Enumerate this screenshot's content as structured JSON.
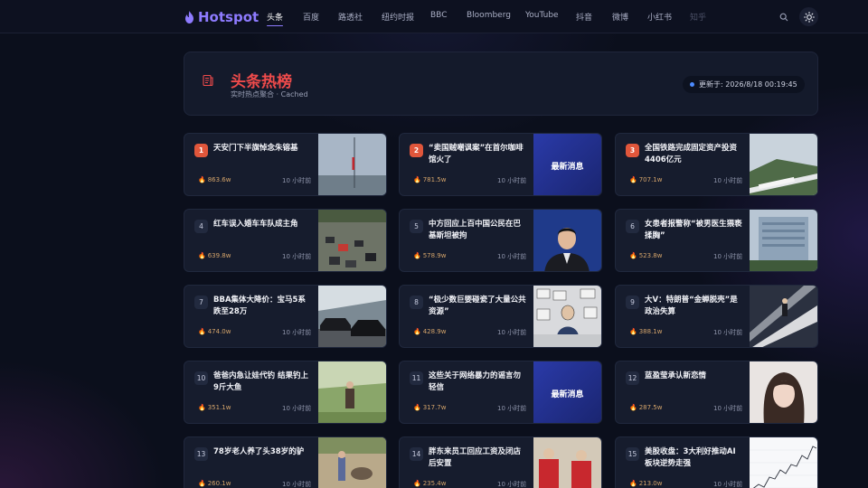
{
  "app": {
    "name": "Hotspot",
    "brand_color": "#8e7bff"
  },
  "nav": {
    "tabs": [
      "头条",
      "百度",
      "路透社",
      "纽约时报",
      "BBC",
      "Bloomberg",
      "YouTube",
      "抖音",
      "微博",
      "小红书",
      "知乎"
    ],
    "active_tab": "头条",
    "icons": [
      "search-icon",
      "sun-icon"
    ]
  },
  "header": {
    "title": "头条热榜",
    "subtitle": "实时热点聚合 · Cached",
    "updated": "更新于: 2026/8/18 00:19:45",
    "title_color": "#ef4b4b"
  },
  "items": [
    {
      "rank": "1",
      "title": "天安门下半旗悼念朱镕基",
      "heat": "863.6w",
      "time": "10 小时前",
      "thumb_text": ""
    },
    {
      "rank": "2",
      "title": "“卖国贼嘲讽案”在首尔咖啡馆火了",
      "heat": "781.5w",
      "time": "10 小时前",
      "thumb_text": "最新消息"
    },
    {
      "rank": "3",
      "title": "全国铁路完成固定资产投资4406亿元",
      "heat": "707.1w",
      "time": "10 小时前",
      "thumb_text": ""
    },
    {
      "rank": "4",
      "title": "红车误入婚车车队成主角",
      "heat": "639.8w",
      "time": "10 小时前",
      "thumb_text": ""
    },
    {
      "rank": "5",
      "title": "中方回应上百中国公民在巴基斯坦被拘",
      "heat": "578.9w",
      "time": "10 小时前",
      "thumb_text": ""
    },
    {
      "rank": "6",
      "title": "女患者报警称“被男医生猥亵揉胸”",
      "heat": "523.8w",
      "time": "10 小时前",
      "thumb_text": ""
    },
    {
      "rank": "7",
      "title": "BBA集体大降价：宝马5系跌至28万",
      "heat": "474.0w",
      "time": "10 小时前",
      "thumb_text": ""
    },
    {
      "rank": "8",
      "title": "“极少数巨婴碰瓷了大量公共资源”",
      "heat": "428.9w",
      "time": "10 小时前",
      "thumb_text": ""
    },
    {
      "rank": "9",
      "title": "大V：特朗普“金蝉脱壳”是政治失算",
      "heat": "388.1w",
      "time": "10 小时前",
      "thumb_text": ""
    },
    {
      "rank": "10",
      "title": "爸爸内急让娃代钓 结果钓上9斤大鱼",
      "heat": "351.1w",
      "time": "10 小时前",
      "thumb_text": ""
    },
    {
      "rank": "11",
      "title": "这些关于网络暴力的谣言勿轻信",
      "heat": "317.7w",
      "time": "10 小时前",
      "thumb_text": "最新消息"
    },
    {
      "rank": "12",
      "title": "蓝盈莹承认新恋情",
      "heat": "287.5w",
      "time": "10 小时前",
      "thumb_text": ""
    },
    {
      "rank": "13",
      "title": "78岁老人养了头38岁的驴",
      "heat": "260.1w",
      "time": "10 小时前",
      "thumb_text": ""
    },
    {
      "rank": "14",
      "title": "胖东来员工回应工资及闭店后安置",
      "heat": "235.4w",
      "time": "10 小时前",
      "thumb_text": ""
    },
    {
      "rank": "15",
      "title": "美股收盘：3大利好推动AI板块逆势走强",
      "heat": "213.0w",
      "time": "10 小时前",
      "thumb_text": ""
    }
  ]
}
